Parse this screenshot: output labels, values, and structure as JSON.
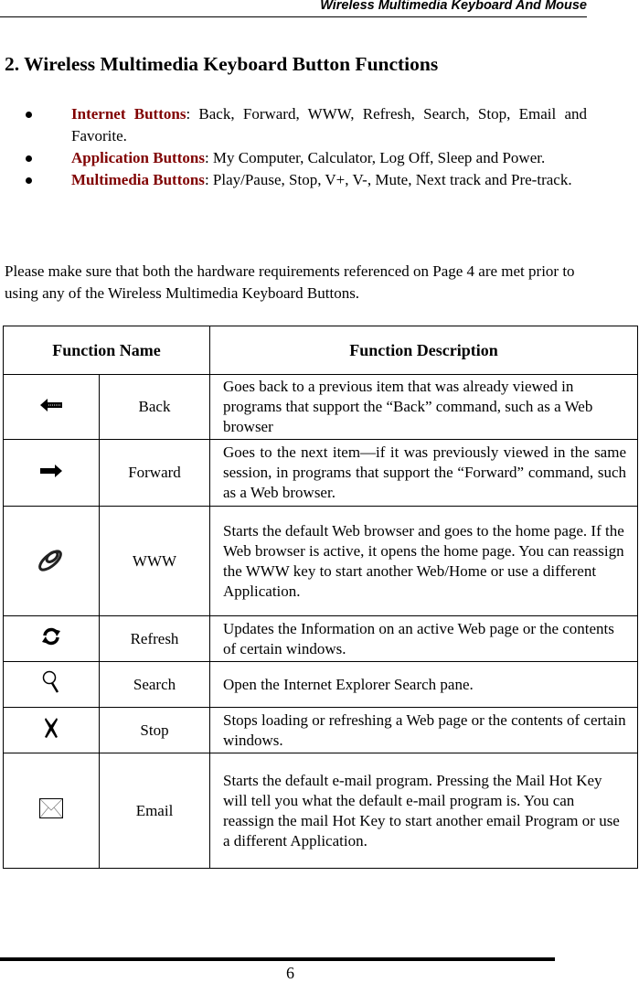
{
  "header": {
    "title": "Wireless Multimedia Keyboard And Mouse"
  },
  "section": {
    "title": "2. Wireless Multimedia Keyboard Button Functions"
  },
  "bullets": [
    {
      "label": "Internet Buttons",
      "text": ": Back, Forward, WWW, Refresh, Search, Stop, Email and Favorite."
    },
    {
      "label": "Application Buttons",
      "text": ": My Computer, Calculator, Log Off, Sleep and Power."
    },
    {
      "label": "Multimedia Buttons",
      "text": ": Play/Pause, Stop, V+, V-, Mute, Next track and Pre-track."
    }
  ],
  "note": "Please make sure that both the hardware requirements referenced on Page 4 are met prior to using any of the Wireless Multimedia Keyboard Buttons.",
  "table": {
    "headers": [
      "Function Name",
      "Function Description"
    ],
    "rows": [
      {
        "icon": "back-arrow-icon",
        "name": "Back",
        "desc": "Goes back to a previous item that was already viewed in programs that support the “Back” command, such as a Web browser"
      },
      {
        "icon": "forward-arrow-icon",
        "name": "Forward",
        "desc": "Goes to the next item—if it was previously viewed in the same session, in programs that support the “Forward” command, such as a Web browser."
      },
      {
        "icon": "www-link-icon",
        "name": "WWW",
        "desc": "Starts the default Web browser and goes to the home page. If the Web browser is active, it opens the home page. You can reassign the WWW key to start another Web/Home or use a different Application."
      },
      {
        "icon": "refresh-icon",
        "name": "Refresh",
        "desc": "Updates the Information on an active Web page or the contents of certain windows."
      },
      {
        "icon": "search-icon",
        "name": "Search",
        "desc": "Open the Internet Explorer Search pane."
      },
      {
        "icon": "stop-icon",
        "name": "Stop",
        "desc": "Stops loading or refreshing a Web page or the contents of certain windows."
      },
      {
        "icon": "email-envelope-icon",
        "name": "Email",
        "desc": "Starts the default e-mail program. Pressing the Mail Hot Key will tell you what the default e-mail program is. You can reassign the mail Hot Key to start another email Program or use a different Application."
      }
    ]
  },
  "footer": {
    "page_number": "6"
  },
  "colors": {
    "keyword": "#800000"
  }
}
